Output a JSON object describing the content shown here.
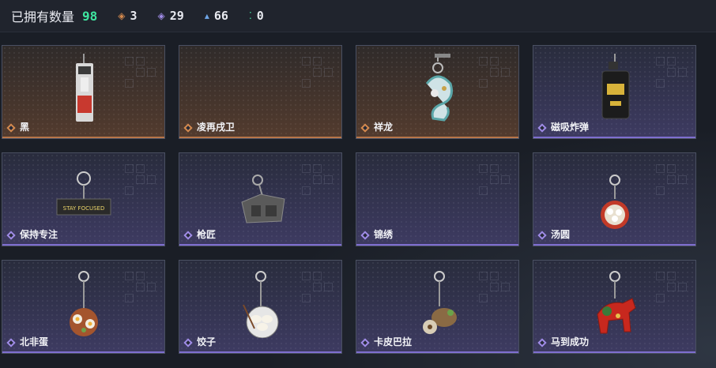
{
  "header": {
    "owned_label": "已拥有数量",
    "owned_count": "98",
    "stats": [
      {
        "icon": "orange-diamond-icon",
        "color": "#d58a4e",
        "value": "3"
      },
      {
        "icon": "purple-diamond-icon",
        "color": "#a08ce8",
        "value": "29"
      },
      {
        "icon": "blue-diamond-icon",
        "color": "#6ea6e8",
        "value": "66"
      },
      {
        "icon": "green-dots-icon",
        "color": "#3ee6a0",
        "value": "0"
      }
    ]
  },
  "rarity_colors": {
    "orange": "#d58a4e",
    "purple": "#a08ce8"
  },
  "items": [
    {
      "name": "黑",
      "rarity": "orange",
      "art": "red-battery-pendant"
    },
    {
      "name": "凌再戌卫",
      "rarity": "orange",
      "art": "none"
    },
    {
      "name": "祥龙",
      "rarity": "orange",
      "art": "dragon-pendant"
    },
    {
      "name": "磁吸炸弹",
      "rarity": "purple",
      "art": "bomb-pendant"
    },
    {
      "name": "保持专注",
      "rarity": "purple",
      "art": "stay-focused-tag"
    },
    {
      "name": "枪匠",
      "rarity": "purple",
      "art": "gun-receiver-pendant"
    },
    {
      "name": "锦绣",
      "rarity": "purple",
      "art": "none"
    },
    {
      "name": "汤圆",
      "rarity": "purple",
      "art": "tangyuan-bowl-pendant"
    },
    {
      "name": "北非蛋",
      "rarity": "purple",
      "art": "shakshuka-pendant"
    },
    {
      "name": "饺子",
      "rarity": "purple",
      "art": "dumpling-plate-pendant"
    },
    {
      "name": "卡皮巴拉",
      "rarity": "purple",
      "art": "capybara-pendant"
    },
    {
      "name": "马到成功",
      "rarity": "purple",
      "art": "red-horse-pendant"
    }
  ]
}
